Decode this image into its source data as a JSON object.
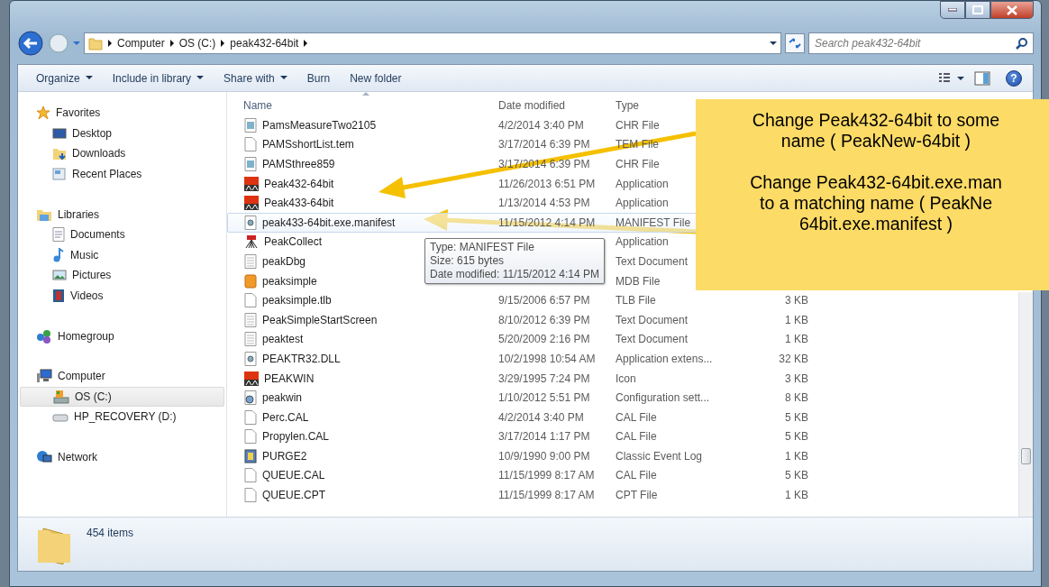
{
  "address": {
    "crumbs": [
      "Computer",
      "OS (C:)",
      "peak432-64bit"
    ]
  },
  "search": {
    "placeholder": "Search peak432-64bit"
  },
  "toolbar": {
    "buttons": [
      {
        "label": "Organize",
        "dropdown": true
      },
      {
        "label": "Include in library",
        "dropdown": true
      },
      {
        "label": "Share with",
        "dropdown": true
      },
      {
        "label": "Burn",
        "dropdown": false
      },
      {
        "label": "New folder",
        "dropdown": false
      }
    ],
    "help_button": {
      "label": "?"
    }
  },
  "sidebar": {
    "groups": [
      {
        "label": "Favorites",
        "kind": "star",
        "items": [
          {
            "label": "Desktop",
            "kind": "desktop",
            "selected": false
          },
          {
            "label": "Downloads",
            "kind": "download",
            "selected": false
          },
          {
            "label": "Recent Places",
            "kind": "recent",
            "selected": false
          }
        ]
      },
      {
        "label": "Libraries",
        "kind": "library",
        "items": [
          {
            "label": "Documents",
            "kind": "doc",
            "selected": false
          },
          {
            "label": "Music",
            "kind": "music",
            "selected": false
          },
          {
            "label": "Pictures",
            "kind": "picture",
            "selected": false
          },
          {
            "label": "Videos",
            "kind": "video",
            "selected": false
          }
        ]
      },
      {
        "label": "Homegroup",
        "kind": "homegroup"
      },
      {
        "label": "Computer",
        "kind": "computer",
        "items": [
          {
            "label": "OS (C:)",
            "kind": "osdrive",
            "selected": true
          },
          {
            "label": "HP_RECOVERY (D:)",
            "kind": "drive",
            "selected": false
          }
        ]
      },
      {
        "label": "Network",
        "kind": "network"
      }
    ]
  },
  "columns": [
    "Name",
    "Date modified",
    "Type"
  ],
  "files": [
    {
      "name": "PamsMeasureTwo2105",
      "date": "4/2/2014 3:40 PM",
      "type": "CHR File",
      "kind": "chr",
      "hovered": false
    },
    {
      "name": "PAMSshortList.tem",
      "date": "3/17/2014 6:39 PM",
      "type": "TEM File",
      "kind": "blank",
      "hovered": false
    },
    {
      "name": "PAMSthree859",
      "date": "3/17/2014 6:39 PM",
      "type": "CHR File",
      "kind": "chr",
      "hovered": false
    },
    {
      "name": "Peak432-64bit",
      "date": "11/26/2013 6:51 PM",
      "type": "Application",
      "kind": "app",
      "hovered": false
    },
    {
      "name": "Peak433-64bit",
      "date": "1/13/2014 4:53 PM",
      "type": "Application",
      "kind": "app",
      "hovered": false
    },
    {
      "name": "peak433-64bit.exe.manifest",
      "date": "11/15/2012 4:14 PM",
      "type": "MANIFEST File",
      "kind": "gear",
      "hovered": true
    },
    {
      "name": "PeakCollect",
      "type": "Application",
      "kind": "collect",
      "hovered": false
    },
    {
      "name": "peakDbg",
      "type": "Text Document",
      "kind": "text",
      "hovered": false
    },
    {
      "name": "peaksimple",
      "type": "MDB File",
      "kind": "mdb",
      "hovered": false
    },
    {
      "name": "peaksimple.tlb",
      "date": "9/15/2006 6:57 PM",
      "type": "TLB File",
      "size": "3 KB",
      "kind": "blank",
      "hovered": false
    },
    {
      "name": "PeakSimpleStartScreen",
      "date": "8/10/2012 6:39 PM",
      "type": "Text Document",
      "size": "1 KB",
      "kind": "text",
      "hovered": false
    },
    {
      "name": "peaktest",
      "date": "5/20/2009 2:16 PM",
      "type": "Text Document",
      "size": "1 KB",
      "kind": "text",
      "hovered": false
    },
    {
      "name": "PEAKTR32.DLL",
      "date": "10/2/1998 10:54 AM",
      "type": "Application extens...",
      "size": "32 KB",
      "kind": "gear",
      "hovered": false
    },
    {
      "name": "PEAKWIN",
      "date": "3/29/1995 7:24 PM",
      "type": "Icon",
      "size": "3 KB",
      "kind": "app",
      "hovered": false
    },
    {
      "name": "peakwin",
      "date": "1/10/2012 5:51 PM",
      "type": "Configuration sett...",
      "size": "8 KB",
      "kind": "config",
      "hovered": false
    },
    {
      "name": "Perc.CAL",
      "date": "4/2/2014 3:40 PM",
      "type": "CAL File",
      "size": "5 KB",
      "kind": "blank",
      "hovered": false
    },
    {
      "name": "Propylen.CAL",
      "date": "3/17/2014 1:17 PM",
      "type": "CAL File",
      "size": "5 KB",
      "kind": "blank",
      "hovered": false
    },
    {
      "name": "PURGE2",
      "date": "10/9/1990 9:00 PM",
      "type": "Classic Event Log",
      "size": "1 KB",
      "kind": "log",
      "hovered": false
    },
    {
      "name": "QUEUE.CAL",
      "date": "11/15/1999 8:17 AM",
      "type": "CAL File",
      "size": "5 KB",
      "kind": "blank",
      "hovered": false
    },
    {
      "name": "QUEUE.CPT",
      "date": "11/15/1999 8:17 AM",
      "type": "CPT File",
      "size": "1 KB",
      "kind": "blank",
      "hovered": false
    }
  ],
  "tooltip": {
    "lines": [
      "Type: MANIFEST File",
      "Size: 615 bytes",
      "Date modified: 11/15/2012 4:14 PM"
    ]
  },
  "status": {
    "count": "454 items"
  },
  "callout": {
    "paragraphs": [
      [
        "Change Peak432-64bit to some",
        "name ( PeakNew-64bit )"
      ],
      [
        "Change Peak432-64bit.exe.man",
        "to a matching name ( PeakNe",
        "64bit.exe.manifest )"
      ]
    ]
  }
}
